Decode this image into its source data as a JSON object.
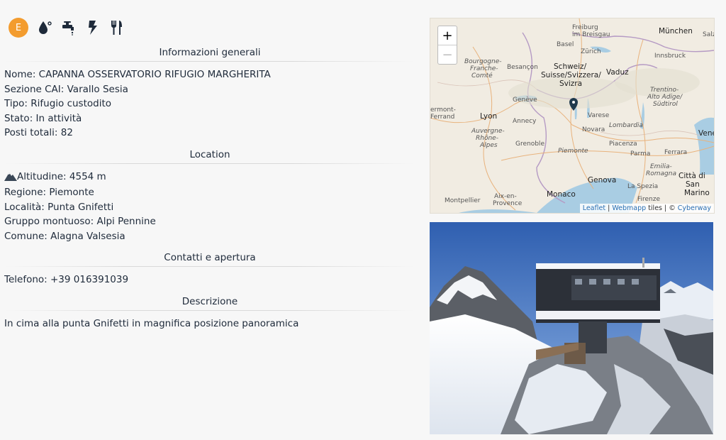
{
  "icons": {
    "badge_letter": "E",
    "list": [
      "water-drop-icon",
      "faucet-icon",
      "lightning-icon",
      "fork-knife-icon"
    ]
  },
  "sections": {
    "general": {
      "title": "Informazioni generali",
      "nome_label": "Nome: ",
      "nome": "CAPANNA OSSERVATORIO RIFUGIO MARGHERITA",
      "sezione_label": "Sezione CAI: ",
      "sezione": "Varallo Sesia",
      "tipo_label": "Tipo: ",
      "tipo": "Rifugio custodito",
      "stato_label": "Stato: ",
      "stato": "In attività",
      "posti_label": "Posti totali: ",
      "posti": "82"
    },
    "location": {
      "title": "Location",
      "altitudine_label": "Altitudine: ",
      "altitudine": "4554 m",
      "regione_label": "Regione: ",
      "regione": "Piemonte",
      "localita_label": "Località: ",
      "localita": "Punta Gnifetti",
      "gruppo_label": "Gruppo montuoso: ",
      "gruppo": "Alpi Pennine",
      "comune_label": "Comune: ",
      "comune": "Alagna Valsesia"
    },
    "contatti": {
      "title": "Contatti e apertura",
      "telefono_label": "Telefono: ",
      "telefono": "+39 016391039"
    },
    "descrizione": {
      "title": "Descrizione",
      "text": "In cima alla punta Gnifetti in magnifica posizione panoramica"
    }
  },
  "map": {
    "zoom_in": "+",
    "zoom_out": "−",
    "attribution": {
      "leaflet": "Leaflet",
      "sep1": " | ",
      "webmapp": "Webmapp",
      "tiles": " tiles | © ",
      "cyberway": "Cyberway"
    },
    "labels": {
      "freiburg": "Freiburg",
      "breisgau": "im Breisgau",
      "munchen": "München",
      "salz": "Salz",
      "basel": "Basel",
      "zurich": "Zürich",
      "innsbruck": "Innsbruck",
      "bourgogne": "Bourgogne-",
      "franche": "Franche-",
      "comte": "Comté",
      "besancon": "Besançon",
      "schweiz": "Schweiz/",
      "suisse": "Suisse/Svizzera/",
      "svizra": "Svizra",
      "vaduz": "Vaduz",
      "trentino": "Trentino-",
      "alto": "Alto Adige/",
      "sudtirol": "Südtirol",
      "geneve": "Genève",
      "clermont": "ermont-",
      "ferrand": "Ferrand",
      "lyon": "Lyon",
      "annecy": "Annecy",
      "varese": "Varese",
      "auvergne": "Auvergne-",
      "rhone": "Rhône-",
      "alpes": "Alpes",
      "novara": "Novara",
      "lombardia": "Lombardia",
      "vene": "Vene",
      "grenoble": "Grenoble",
      "piemonte": "Piemonte",
      "piacenza": "Piacenza",
      "parma": "Parma",
      "ferrara": "Ferrara",
      "emilia": "Emilia-",
      "romagna": "Romagna",
      "genova": "Genova",
      "citta": "Città di",
      "sanmarino": "San",
      "marino": "Marino",
      "monaco": "Monaco",
      "laspezia": "La Spezia",
      "montpellier": "Montpellier",
      "aix": "Aix-en-",
      "provence": "Provence",
      "firenze": "Firenze"
    }
  },
  "colors": {
    "badge": "#f39c2f",
    "text": "#1e2a3a",
    "link": "#2a6fb3",
    "marker": "#1f3a4d"
  }
}
